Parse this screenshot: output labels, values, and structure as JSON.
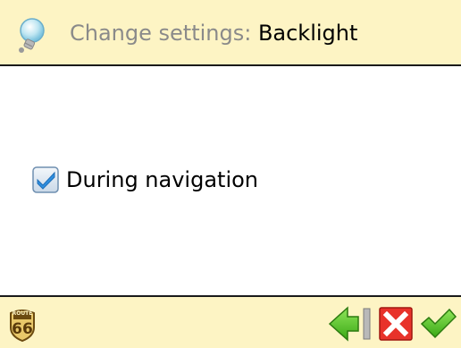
{
  "header": {
    "title_prefix": "Change settings: ",
    "title_name": "Backlight"
  },
  "options": [
    {
      "label": "During navigation",
      "checked": true
    }
  ],
  "footer": {
    "logo_top": "ROUTE",
    "logo_number": "66"
  },
  "icons": {
    "header": "lightbulb-icon",
    "checkbox": "checkmark-icon",
    "back": "back-arrow-icon",
    "cancel": "close-icon",
    "ok": "checkmark-icon"
  },
  "colors": {
    "header_background": "#fdf4c4",
    "cancel_red": "#e8322a",
    "ok_green": "#4cc21d",
    "checkbox_blue": "#2f8fe0"
  }
}
